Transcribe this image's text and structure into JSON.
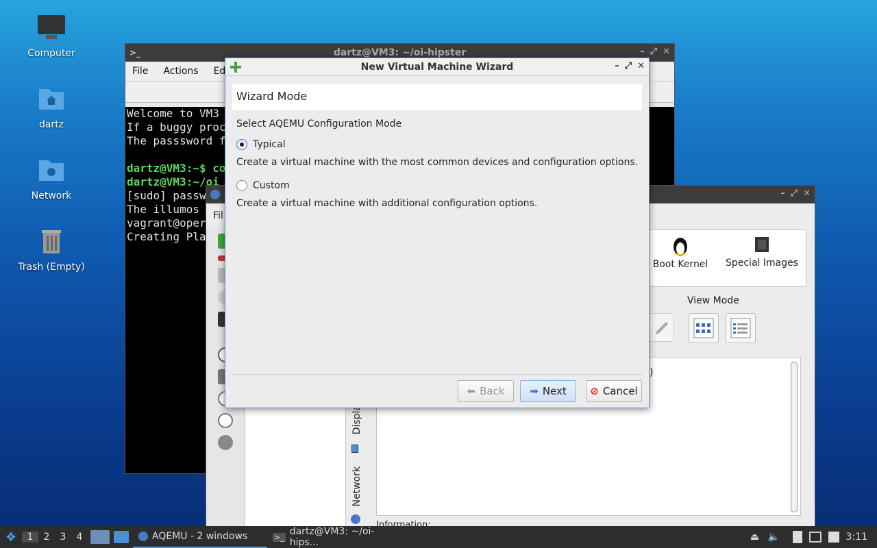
{
  "desktop": {
    "icons": [
      {
        "label": "Computer"
      },
      {
        "label": "dartz"
      },
      {
        "label": "Network"
      },
      {
        "label": "Trash (Empty)"
      }
    ]
  },
  "terminal": {
    "title": "dartz@VM3: ~/oi-hipster",
    "menu": [
      "File",
      "Actions",
      "Ed"
    ],
    "lines": [
      "Welcome to VM3",
      "If a buggy proc",
      "The passsword f",
      "",
      "dartz@VM3:~$ co",
      "dartz@VM3:~/oi",
      "[sudo] passw",
      "The illumos",
      "vagrant@oper",
      "Creating Pla"
    ]
  },
  "aqemu": {
    "menu_fragment": "Fil",
    "toolbar": {
      "boot_kernel": "Boot Kernel",
      "special_images": "Special Images"
    },
    "view_mode_label": "View Mode",
    "tabs": {
      "display": "Displa",
      "network": "Network"
    },
    "info_fragment": "Information:",
    "paren_fragment": ")"
  },
  "wizard": {
    "title": "New Virtual Machine Wizard",
    "header": "Wizard Mode",
    "prompt": "Select AQEMU Configuration Mode",
    "options": [
      {
        "label": "Typical",
        "description": "Create a virtual machine with the most common devices and configuration options.",
        "selected": true
      },
      {
        "label": "Custom",
        "description": "Create a virtual machine with additional configuration options.",
        "selected": false
      }
    ],
    "buttons": {
      "back": "Back",
      "next": "Next",
      "cancel": "Cancel"
    }
  },
  "taskbar": {
    "workspaces": [
      "1",
      "2",
      "3",
      "4"
    ],
    "active_workspace": "1",
    "tasks": [
      "AQEMU - 2 windows",
      "dartz@VM3: ~/oi-hips..."
    ],
    "clock": "3:11"
  },
  "colors": {
    "accent": "#3a74c4",
    "terminal_prompt": "#5cd65c",
    "terminal_path": "#6fa0ff"
  }
}
